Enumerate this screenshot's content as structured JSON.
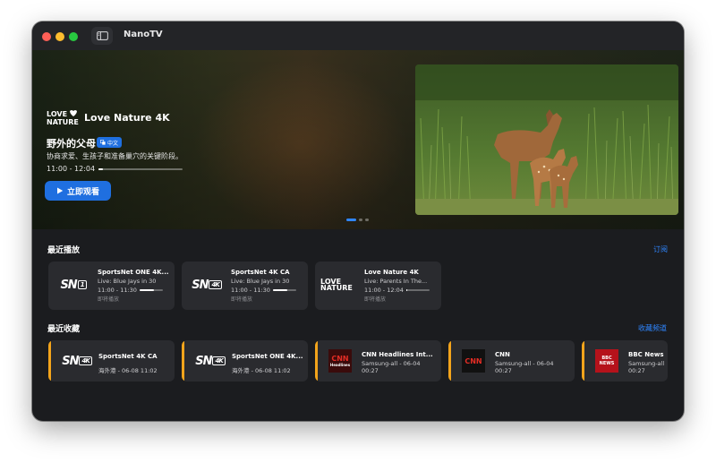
{
  "app": {
    "title": "NanoTV"
  },
  "hero": {
    "channel_logo_text": "LOVE NATURE",
    "channel_name": "Love Nature 4K",
    "program_title": "野外的父母",
    "language_badge": "中文",
    "description": "协商求爱、生孩子和准备巢穴的关键阶段。",
    "time_range": "11:00 - 12:04",
    "progress": 0.05,
    "watch_label": "立即观看",
    "carousel": {
      "count": 3,
      "active": 0
    }
  },
  "recent": {
    "title": "最近播放",
    "link": "订阅",
    "items": [
      {
        "logo": "sn1",
        "logo_text": "SN",
        "logo_badge": "1",
        "name": "SportsNet ONE 4K...",
        "program": "Live: Blue Jays in 30",
        "time": "11:00 - 11:30",
        "progress": 0.6,
        "status": "即将播放"
      },
      {
        "logo": "sn4k",
        "logo_text": "SN",
        "logo_badge": "4K",
        "name": "SportsNet 4K CA",
        "program": "Live: Blue Jays in 30",
        "time": "11:00 - 11:30",
        "progress": 0.6,
        "status": "即将播放"
      },
      {
        "logo": "lovenature",
        "logo_text": "LOVE NATURE",
        "name": "Love Nature 4K",
        "program": "Live: Parents In The...",
        "time": "11:00 - 12:04",
        "progress": 0.05,
        "status": "即将播放"
      }
    ]
  },
  "favorites": {
    "title": "最近收藏",
    "link": "收藏频道",
    "items": [
      {
        "logo": "sn4k",
        "logo_text": "SN",
        "logo_badge": "4K",
        "name": "SportsNet 4K CA",
        "sub": "海外港 - 06-08 11:02",
        "time": ""
      },
      {
        "logo": "sn4k",
        "logo_text": "SN",
        "logo_badge": "4K",
        "name": "SportsNet ONE 4K...",
        "sub": "海外港 - 06-08 11:02",
        "time": ""
      },
      {
        "logo": "cnn-hl",
        "logo_text": "CNN",
        "logo_caption": "Headlines",
        "name": "CNN Headlines Int...",
        "sub": "Samsung-all - 06-04",
        "time": "00:27"
      },
      {
        "logo": "cnn",
        "logo_text": "CNN",
        "name": "CNN",
        "sub": "Samsung-all - 06-04",
        "time": "00:27"
      },
      {
        "logo": "bbc",
        "logo_text": "BBC",
        "logo_caption": "NEWS",
        "name": "BBC News",
        "sub": "Samsung-all",
        "time": "00:27"
      }
    ]
  },
  "colors": {
    "accent": "#1f6fe0",
    "link": "#2f86ff",
    "favorite_bar": "#f3a41b",
    "card": "#2a2b2f",
    "window": "#1b1c1f"
  }
}
